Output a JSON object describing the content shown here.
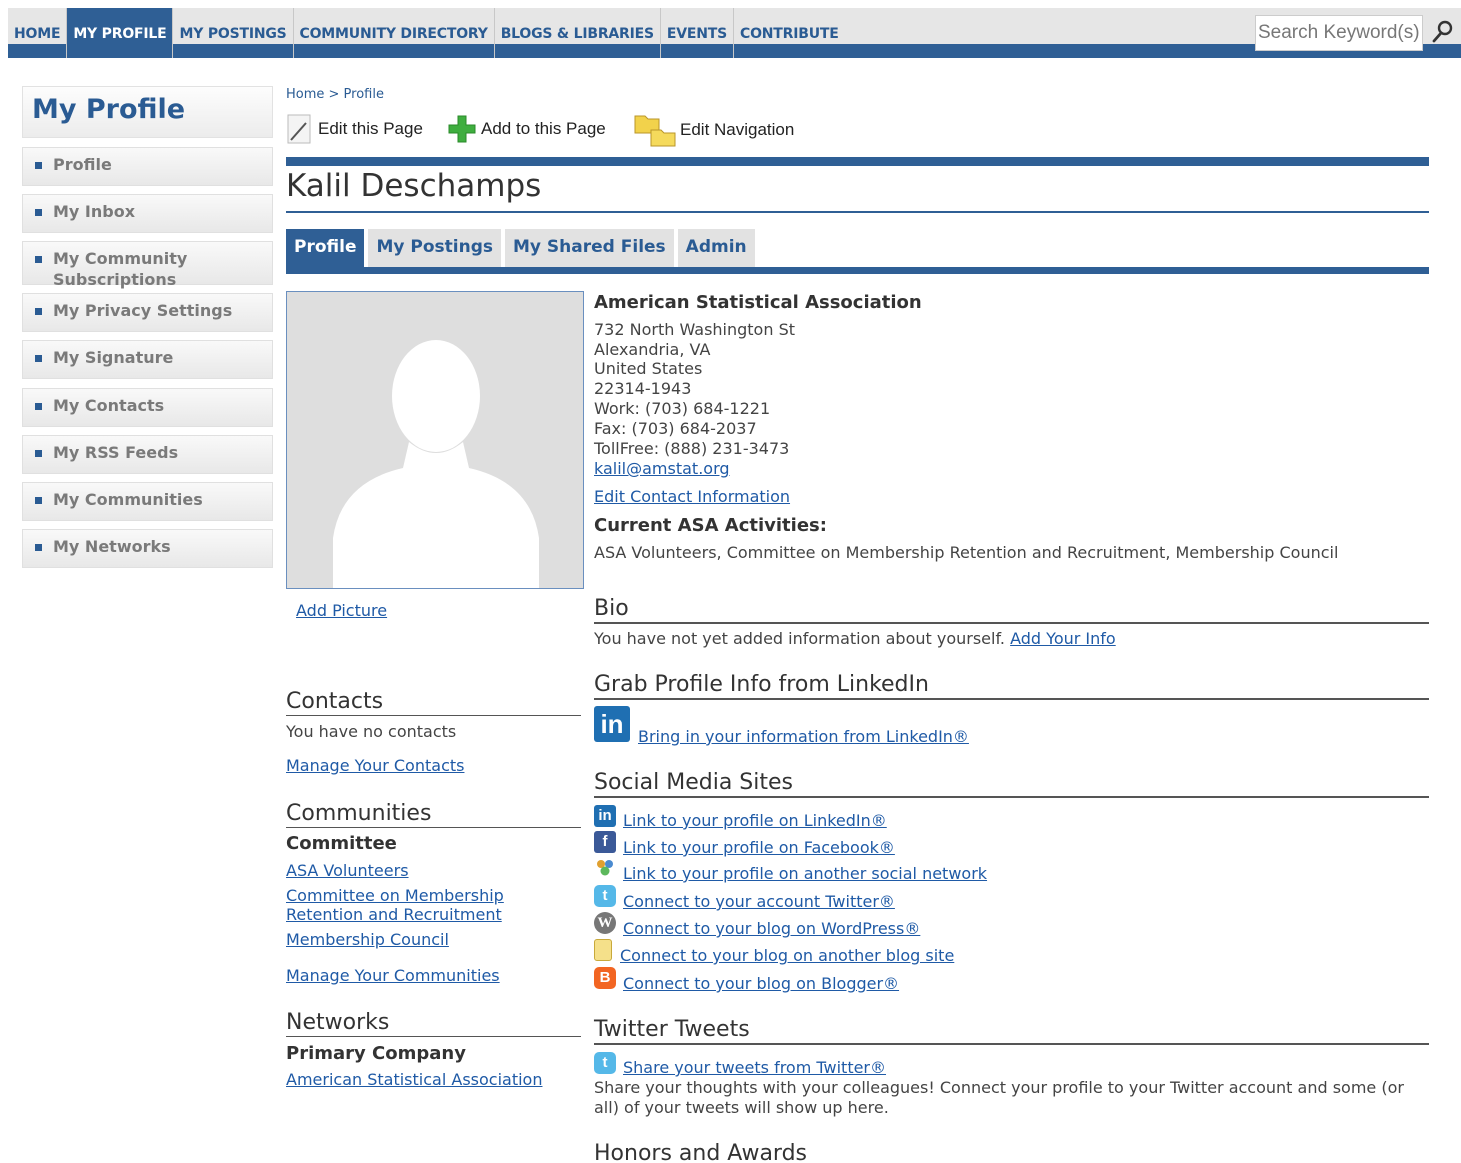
{
  "nav": {
    "items": [
      {
        "label": "HOME"
      },
      {
        "label": "MY PROFILE"
      },
      {
        "label": "MY POSTINGS"
      },
      {
        "label": "COMMUNITY DIRECTORY"
      },
      {
        "label": "BLOGS & LIBRARIES"
      },
      {
        "label": "EVENTS"
      },
      {
        "label": "CONTRIBUTE"
      }
    ],
    "active_index": 1,
    "search_placeholder": "Search Keyword(s)"
  },
  "sidebar": {
    "title": "My Profile",
    "items": [
      {
        "label": "Profile"
      },
      {
        "label": "My Inbox"
      },
      {
        "label": "My Community Subscriptions"
      },
      {
        "label": "My Privacy Settings"
      },
      {
        "label": "My Signature"
      },
      {
        "label": "My Contacts"
      },
      {
        "label": "My RSS Feeds"
      },
      {
        "label": "My Communities"
      },
      {
        "label": "My Networks"
      }
    ]
  },
  "breadcrumb": "Home > Profile",
  "toolbar": {
    "edit_page": "Edit this Page",
    "add_page": "Add to this Page",
    "edit_nav": "Edit Navigation"
  },
  "profile": {
    "name": "Kalil Deschamps",
    "tabs": [
      {
        "label": "Profile"
      },
      {
        "label": "My Postings"
      },
      {
        "label": "My Shared Files"
      },
      {
        "label": "Admin"
      }
    ],
    "add_picture": "Add Picture"
  },
  "contact": {
    "organization": "American Statistical Association",
    "street": "732 North Washington St",
    "city": "Alexandria, VA",
    "country": "United States",
    "zip": "22314-1943",
    "work": "Work: (703) 684-1221",
    "fax": "Fax: (703) 684-2037",
    "tollfree": "TollFree: (888) 231-3473",
    "email": "kalil@amstat.org",
    "edit_link": "Edit Contact Information",
    "activities_heading": "Current ASA Activities:",
    "activities": "ASA Volunteers, Committee on Membership Retention and Recruitment, Membership Council"
  },
  "bio": {
    "heading": "Bio",
    "text": "You have not yet added information about yourself.",
    "link": "Add Your Info"
  },
  "linkedin": {
    "heading": "Grab Profile Info from LinkedIn",
    "link": "Bring in your information from LinkedIn®"
  },
  "social": {
    "heading": "Social Media Sites",
    "links": [
      {
        "label": "Link to your profile on LinkedIn®",
        "icon": "linkedin-icon"
      },
      {
        "label": "Link to your profile on Facebook®",
        "icon": "facebook-icon"
      },
      {
        "label": "Link to your profile on another social network",
        "icon": "people-icon"
      },
      {
        "label": "Connect to your account Twitter®",
        "icon": "twitter-icon"
      },
      {
        "label": "Connect to your blog on WordPress®",
        "icon": "wordpress-icon"
      },
      {
        "label": "Connect to your blog on another blog site",
        "icon": "document-icon"
      },
      {
        "label": "Connect to your blog on Blogger®",
        "icon": "blogger-icon"
      }
    ]
  },
  "twitter": {
    "heading": "Twitter Tweets",
    "link": "Share your tweets from Twitter®",
    "text_line1": "Share your thoughts with your colleagues! Connect your profile to your Twitter account and some (or",
    "text_line2": "all) of your tweets will show up here."
  },
  "honors": {
    "heading": "Honors and Awards"
  },
  "contacts": {
    "heading": "Contacts",
    "text": "You have no contacts",
    "link": "Manage Your Contacts"
  },
  "communities": {
    "heading": "Communities",
    "subheading": "Committee",
    "items": [
      {
        "label": "ASA Volunteers"
      },
      {
        "label": "Committee on Membership"
      },
      {
        "label": "Retention and Recruitment"
      },
      {
        "label": "Membership Council"
      }
    ],
    "manage_link": "Manage Your Communities"
  },
  "networks": {
    "heading": "Networks",
    "subheading": "Primary Company",
    "link": "American Statistical Association"
  },
  "colors": {
    "brand_blue": "#2f5f95",
    "link_blue": "#1f5aa6",
    "nav_gray": "#e6e6e6"
  }
}
